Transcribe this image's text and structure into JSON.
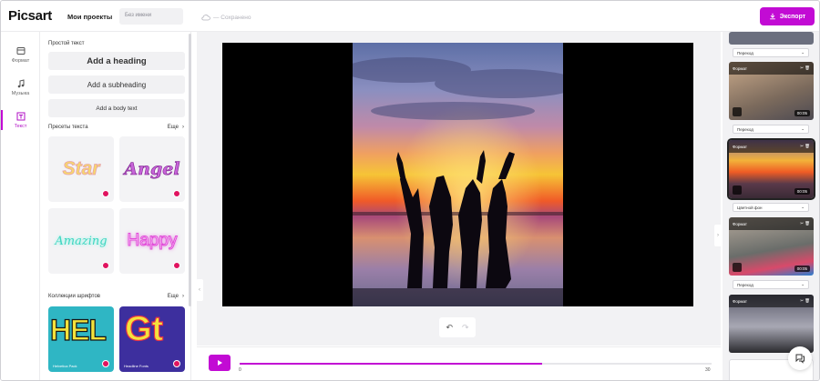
{
  "header": {
    "logo": "Picsart",
    "projects_link": "Мои проекты",
    "project_name_placeholder": "Без имени",
    "saved_status": "— Сохранено",
    "export_label": "Экспорт"
  },
  "rail": {
    "items": [
      {
        "label": "Формат",
        "icon": "format-icon"
      },
      {
        "label": "Музыка",
        "icon": "music-icon"
      },
      {
        "label": "Текст",
        "icon": "text-icon"
      }
    ]
  },
  "text_panel": {
    "simple_text_title": "Простой текст",
    "heading_btn": "Add a heading",
    "subheading_btn": "Add a subheading",
    "body_btn": "Add a body text",
    "presets_title": "Пресеты текста",
    "presets_more": "Еще",
    "presets": [
      {
        "text": "Star",
        "color": "#f7d96b"
      },
      {
        "text": "Angel",
        "color": "#c764d8"
      },
      {
        "text": "Amazing",
        "color": "#3fd6c0"
      },
      {
        "text": "Happy",
        "color": "#e14bd8"
      }
    ],
    "fonts_title": "Коллекции шрифтов",
    "fonts_more": "Еще",
    "fonts": [
      {
        "preview": "HEL",
        "name": "Helvetica Pack"
      },
      {
        "preview": "Gt",
        "name": "Headline Fonts"
      }
    ]
  },
  "timeline": {
    "start": "0",
    "end": "30",
    "progress": 0.64
  },
  "scenes": {
    "items": [
      {
        "label": "Формат",
        "duration": "00:05"
      },
      {
        "label": "Формат",
        "duration": "00:05"
      },
      {
        "label": "Формат",
        "duration": "00:05"
      },
      {
        "label": "Формат",
        "duration": ""
      }
    ],
    "transitions": [
      "Переход",
      "Переход",
      "Цветной фон",
      "Переход"
    ]
  },
  "colors": {
    "accent": "#c20bd4"
  }
}
